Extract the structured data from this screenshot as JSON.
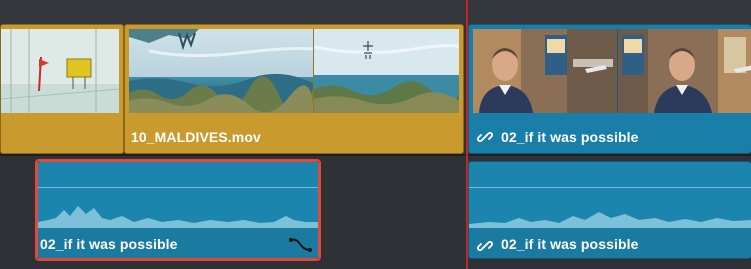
{
  "colors": {
    "video_clip": "#c99a2e",
    "linked_clip": "#1a7fa8",
    "audio_clip": "#1b85ad",
    "playhead": "#c0272d",
    "selection": "#e04a3c"
  },
  "video_track": {
    "clip_1": {
      "label": ""
    },
    "clip_2": {
      "label": "10_MALDIVES.mov"
    },
    "clip_3": {
      "label": "02_if it was possible",
      "icon": "link-icon"
    }
  },
  "audio_track": {
    "clip_1": {
      "label": "02_if it was possible",
      "icon": "keyframe-curve-icon",
      "selected": true
    },
    "clip_2": {
      "label": "02_if it was possible",
      "icon": "link-icon"
    }
  }
}
